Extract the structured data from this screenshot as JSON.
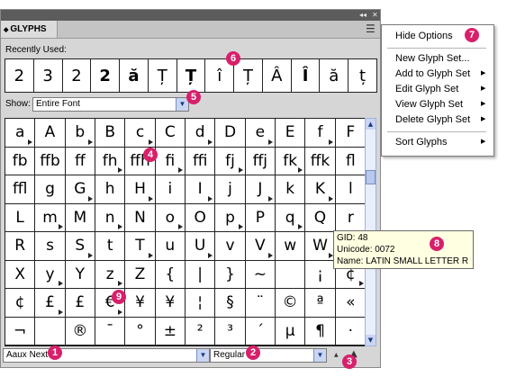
{
  "panel": {
    "collapse_glyph": "◂◂",
    "close_glyph": "✕",
    "tab_arrow": "◆",
    "tab_title": "GLYPHS",
    "menu_glyph": "☰",
    "recent_label": "Recently Used:",
    "recent_glyphs": [
      "2",
      "3",
      "2",
      "2",
      "ă",
      "Ț",
      "Ț",
      "î",
      "Ț",
      "Â",
      "Î",
      "ă",
      "ț"
    ],
    "show_label": "Show:",
    "show_value": "Entire Font",
    "font_value": "Aaux Next",
    "style_value": "Regular",
    "zoom_out_glyph": "▲",
    "zoom_in_glyph": "▲"
  },
  "glyph_grid": [
    "a",
    "A",
    "b",
    "B",
    "c",
    "C",
    "d",
    "D",
    "e",
    "E",
    "f",
    "F",
    "fb",
    "ffb",
    "ff",
    "fh",
    "ffh",
    "fi",
    "ffi",
    "fj",
    "ffj",
    "fk",
    "ffk",
    "fl",
    "ffl",
    "g",
    "G",
    "h",
    "H",
    "i",
    "I",
    "j",
    "J",
    "k",
    "K",
    "l",
    "L",
    "m",
    "M",
    "n",
    "N",
    "o",
    "O",
    "p",
    "P",
    "q",
    "Q",
    "r",
    "R",
    "s",
    "S",
    "t",
    "T",
    "u",
    "U",
    "v",
    "V",
    "w",
    "W",
    "x",
    "X",
    "y",
    "Y",
    "z",
    "Z",
    "{",
    "|",
    "}",
    "~",
    "",
    "¡",
    "¢",
    "¢",
    "£",
    "£",
    "€",
    "¥",
    "¥",
    "¦",
    "§",
    "¨",
    "©",
    "ª",
    "«",
    "¬",
    "",
    "®",
    "¯",
    "°",
    "±",
    "²",
    "³",
    "´",
    "µ",
    "¶",
    "·"
  ],
  "menu": {
    "items": [
      {
        "label": "Hide Options",
        "submenu": false
      },
      {
        "label": "New Glyph Set...",
        "submenu": false
      },
      {
        "label": "Add to Glyph Set",
        "submenu": true
      },
      {
        "label": "Edit Glyph Set",
        "submenu": true
      },
      {
        "label": "View Glyph Set",
        "submenu": true
      },
      {
        "label": "Delete Glyph Set",
        "submenu": true
      },
      {
        "label": "Sort Glyphs",
        "submenu": true
      }
    ]
  },
  "tooltip": {
    "gid": "GID: 48",
    "unicode": "Unicode: 0072",
    "name": "Name: LATIN SMALL LETTER R"
  },
  "callouts": [
    "1",
    "2",
    "3",
    "4",
    "5",
    "6",
    "7",
    "8",
    "9"
  ],
  "colors": {
    "callout": "#d8206a",
    "tooltip_bg": "#ffffe1",
    "panel_bg": "#d6d6d6"
  }
}
